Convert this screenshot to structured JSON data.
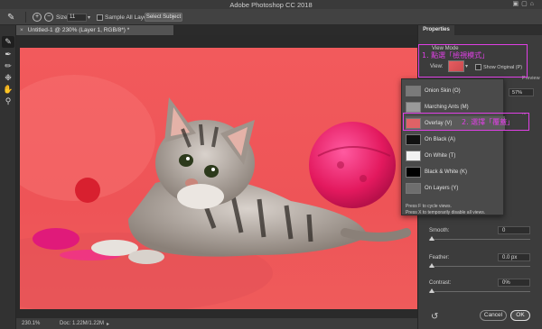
{
  "app": {
    "title": "Adobe Photoshop CC 2018"
  },
  "options_bar": {
    "size_label": "Size:",
    "size_value": "11",
    "sample_all_layers": "Sample All Layers",
    "select_subject": "Select Subject"
  },
  "document": {
    "tab_title": "Untitled-1 @ 230% (Layer 1, RGB/8*) *",
    "zoom": "230.1%",
    "doc_size": "Doc: 1.22M/1.22M"
  },
  "properties": {
    "tab": "Properties",
    "view_mode_title": "View Mode",
    "view_label": "View:",
    "show_original": "Show Original (P)",
    "preview_label": "Preview",
    "hidden_value": "57%",
    "hidden_label": "...",
    "smooth_label": "Smooth:",
    "smooth_value": "0",
    "feather_label": "Feather:",
    "feather_value": "0.0 px",
    "contrast_label": "Contrast:",
    "contrast_value": "0%",
    "cancel": "Cancel",
    "ok": "OK"
  },
  "view_menu": {
    "items": [
      {
        "label": "Onion Skin (O)",
        "thumb": "#7a7a7a"
      },
      {
        "label": "Marching Ants (M)",
        "thumb": "#9a9a9a"
      },
      {
        "label": "Overlay (V)",
        "thumb": "#e06266"
      },
      {
        "label": "On Black (A)",
        "thumb": "#111111"
      },
      {
        "label": "On White (T)",
        "thumb": "#f2f2f2"
      },
      {
        "label": "Black & White (K)",
        "thumb": "#000000"
      },
      {
        "label": "On Layers (Y)",
        "thumb": "#6e6e6e"
      }
    ],
    "hint_line1": "Press F to cycle views.",
    "hint_line2": "Press X to temporarily disable all views."
  },
  "annotations": {
    "step1": "1. 點選「檢視模式」",
    "step2": "2. 選擇「覆蓋」",
    "color": "#e040e6"
  }
}
